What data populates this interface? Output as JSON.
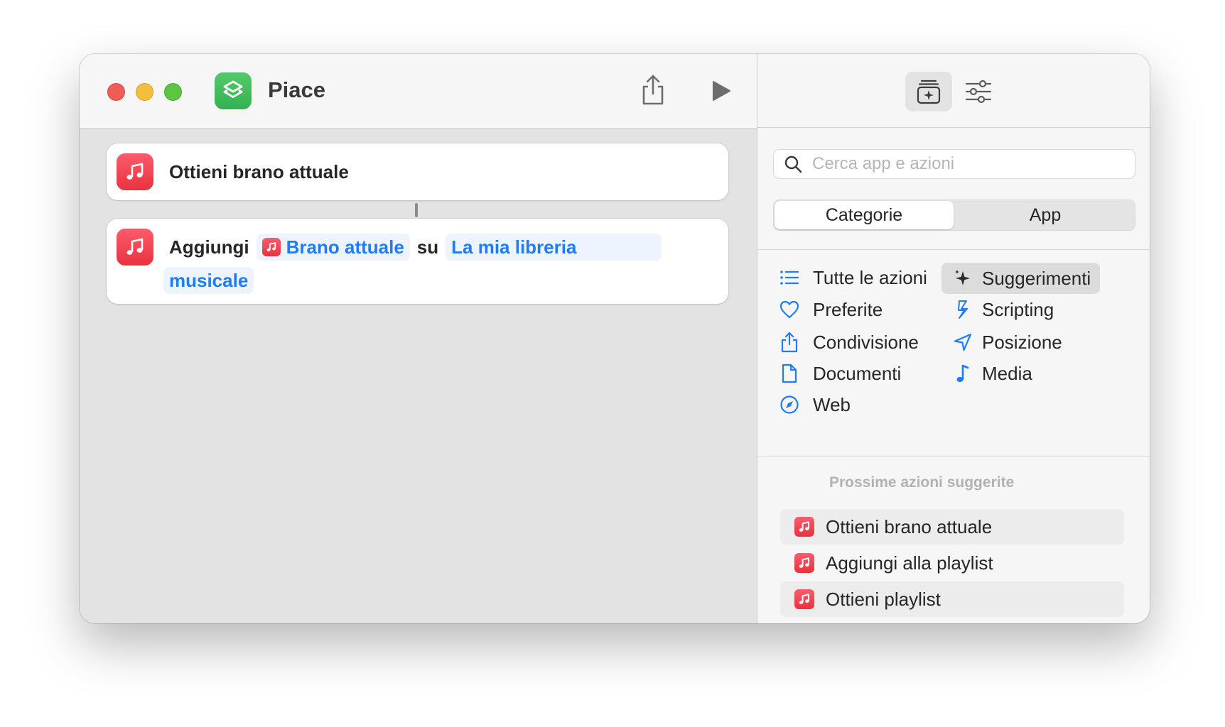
{
  "window": {
    "title": "Piace"
  },
  "workflow": {
    "action1": {
      "label": "Ottieni brano attuale"
    },
    "action2": {
      "verb": "Aggiungi",
      "token_song": "Brano attuale",
      "preposition": "su",
      "token_library_part1": "La mia libreria",
      "token_library_part2": "musicale"
    }
  },
  "sidebar": {
    "search": {
      "placeholder": "Cerca app e azioni",
      "value": ""
    },
    "segments": {
      "active": "Categorie",
      "inactive": "App"
    },
    "categories": [
      {
        "label": "Tutte le azioni",
        "icon": "list-icon"
      },
      {
        "label": "Suggerimenti",
        "icon": "sparkles-icon",
        "selected": true
      },
      {
        "label": "Preferite",
        "icon": "heart-icon"
      },
      {
        "label": "Scripting",
        "icon": "scripting-icon"
      },
      {
        "label": "Condivisione",
        "icon": "share-icon"
      },
      {
        "label": "Posizione",
        "icon": "location-arrow-icon"
      },
      {
        "label": "Documenti",
        "icon": "document-icon"
      },
      {
        "label": "Media",
        "icon": "music-note-icon"
      },
      {
        "label": "Web",
        "icon": "compass-icon"
      }
    ],
    "suggestions_header": "Prossime azioni suggerite",
    "suggestions": [
      {
        "label": "Ottieni brano attuale"
      },
      {
        "label": "Aggiungi alla playlist"
      },
      {
        "label": "Ottieni playlist"
      }
    ]
  },
  "colors": {
    "accent": "#1f7cf5",
    "music_red": "#e9323f",
    "shortcuts_green": "#33b152"
  }
}
